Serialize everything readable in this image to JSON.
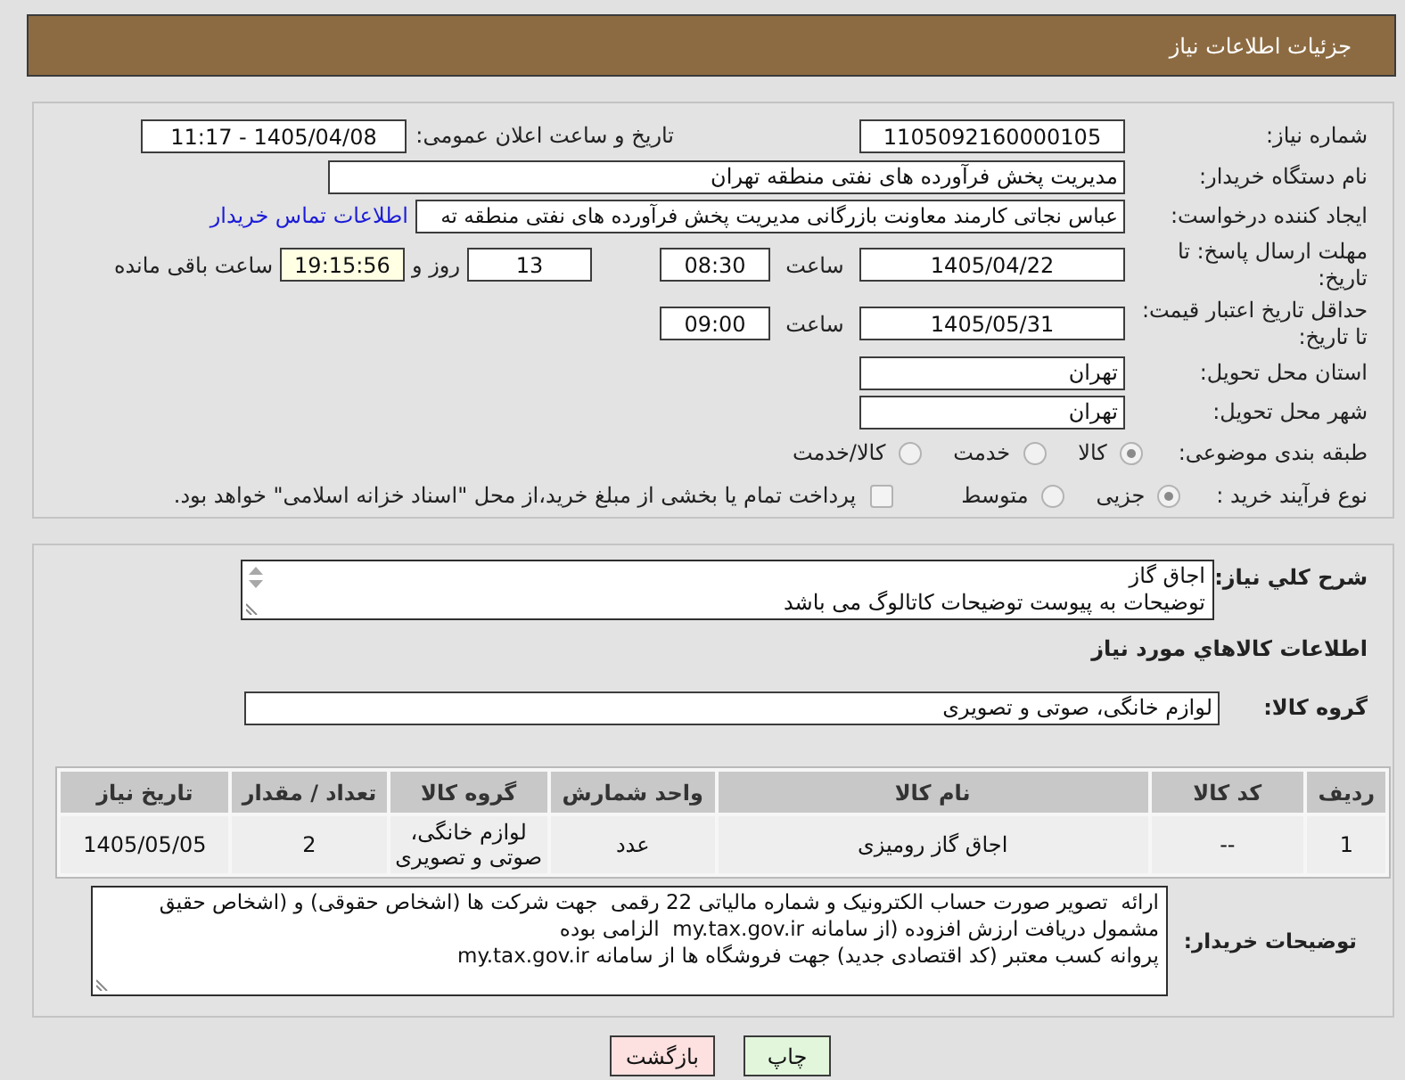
{
  "header": {
    "title": "جزئیات اطلاعات نیاز"
  },
  "details": {
    "need_number": {
      "label": "شماره نیاز:",
      "value": "1105092160000105"
    },
    "announce_datetime": {
      "label": "تاریخ و ساعت اعلان عمومی:",
      "value": "1405/04/08 - 11:17"
    },
    "buyer_org": {
      "label": "نام دستگاه خریدار:",
      "value": "مدیریت پخش فرآورده های نفتی منطقه تهران"
    },
    "requester": {
      "label": "ایجاد کننده درخواست:",
      "value": "عباس نجاتی کارمند معاونت بازرگانی مدیریت پخش فرآورده های نفتی منطقه ته",
      "link": "اطلاعات تماس خریدار"
    },
    "response_deadline": {
      "label": "مهلت ارسال پاسخ: تا تاریخ:",
      "date": "1405/04/22",
      "time_label": "ساعت",
      "time": "08:30",
      "days": "13",
      "days_label": "روز و",
      "remaining": "19:15:56",
      "remaining_label": "ساعت باقی مانده"
    },
    "price_validity": {
      "label": "حداقل تاریخ اعتبار قیمت: تا تاریخ:",
      "date": "1405/05/31",
      "time_label": "ساعت",
      "time": "09:00"
    },
    "delivery_province": {
      "label": "استان محل تحویل:",
      "value": "تهران"
    },
    "delivery_city": {
      "label": "شهر محل تحویل:",
      "value": "تهران"
    },
    "classification": {
      "label": "طبقه بندی موضوعی:",
      "options": [
        {
          "label": "کالا",
          "selected": true
        },
        {
          "label": "خدمت",
          "selected": false
        },
        {
          "label": "کالا/خدمت",
          "selected": false
        }
      ]
    },
    "purchase_process": {
      "label": "نوع فرآیند خرید :",
      "options": [
        {
          "label": "جزیی",
          "selected": true
        },
        {
          "label": "متوسط",
          "selected": false
        }
      ],
      "treasury_payment": {
        "label": "پرداخت تمام یا بخشی از مبلغ خرید،از محل \"اسناد خزانه اسلامی\" خواهد بود.",
        "checked": false
      }
    }
  },
  "description": {
    "label": "شرح کلي نياز:",
    "value": "اجاق گاز\nتوضیحات به پیوست توضیحات کاتالوگ می باشد"
  },
  "goods": {
    "title": "اطلاعات کالاهاي مورد نياز",
    "group": {
      "label": "گروه کالا:",
      "value": "لوازم خانگی، صوتی و تصویری"
    },
    "table": {
      "columns": [
        "ردیف",
        "کد کالا",
        "نام کالا",
        "واحد شمارش",
        "گروه کالا",
        "تعداد / مقدار",
        "تاریخ نیاز"
      ],
      "rows": [
        [
          "1",
          "--",
          "اجاق گاز رومیزی",
          "عدد",
          "لوازم خانگی، صوتی و تصویری",
          "2",
          "1405/05/05"
        ]
      ]
    }
  },
  "buyer_notes": {
    "label": "توضیحات خریدار:",
    "value": "ارائه  تصویر صورت حساب الکترونیک و شماره مالیاتی 22 رقمی  جهت شرکت ها (اشخاص حقوقی) و (اشخاص حقیق\nمشمول دریافت ارزش افزوده (از سامانه my.tax.gov.ir  الزامی بوده\nپروانه کسب معتبر (کد اقتصادی جدید) جهت فروشگاه ها از سامانه my.tax.gov.ir"
  },
  "buttons": [
    {
      "label": "چاپ",
      "kind": "print"
    },
    {
      "label": "بازگشت",
      "kind": "back"
    }
  ]
}
